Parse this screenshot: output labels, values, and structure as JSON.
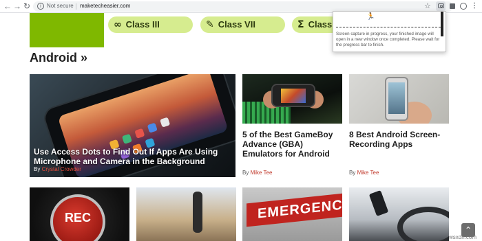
{
  "browser": {
    "back_glyph": "←",
    "forward_glyph": "→",
    "reload_glyph": "↻",
    "info_glyph": "i",
    "security_label": "Not secure",
    "url": "maketecheasier.com",
    "star_glyph": "☆",
    "menu_glyph": "⋮"
  },
  "nav_pills": [
    {
      "icon": "∞",
      "label": "Class III"
    },
    {
      "icon": "✎",
      "label": "Class VII"
    },
    {
      "icon": "Σ",
      "label": "Class"
    }
  ],
  "section": {
    "heading": "Android »"
  },
  "featured": {
    "title": "Use Access Dots to Find Out If Apps Are Using Microphone and Camera in the Background",
    "by_label": "By",
    "author": "Crystal Crowder"
  },
  "cards": [
    {
      "title": "5 of the Best GameBoy Advance (GBA) Emulators for Android",
      "by_label": "By",
      "author": "Mike Tee"
    },
    {
      "title": "8 Best Android Screen-Recording Apps",
      "by_label": "By",
      "author": "Mike Tee"
    }
  ],
  "bottom_thumbs": {
    "rec_label": "REC",
    "emergency_label": "EMERGENCY"
  },
  "popup": {
    "runner_glyph": "🏃",
    "message": "Screen capture in progress, your finished image will open in a new window once completed. Please wait for the progress bar to finish."
  },
  "scroll_top_glyph": "⌃",
  "watermark": "wsxdn.com",
  "colors": {
    "accent_green": "#7fb800",
    "pill_green": "#d6ec8f",
    "author_red": "#c0392b"
  }
}
